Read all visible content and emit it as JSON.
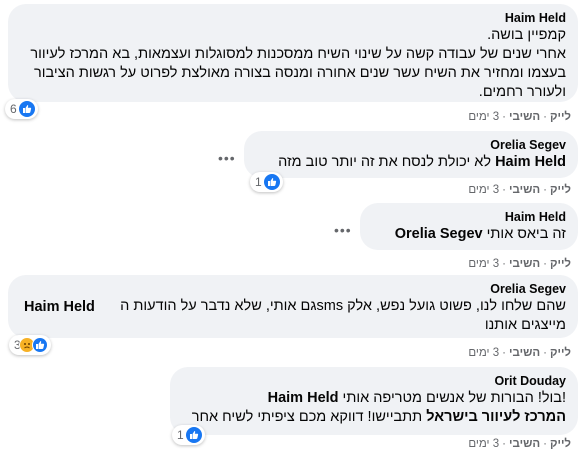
{
  "comments": [
    {
      "author": "Haim Held",
      "text": "קמפיין בושה.\nאחרי שנים של עבודה קשה על שינוי השיח ממסכנות למסוגלות ועצמאות, בא המרכז לעיוור בעצמו ומחזיר את השיח עשר שנים אחורה ומנסה בצורה מאולצת לפרוט על רגשות הציבור ולעורר רחמים.",
      "reaction_count": "6",
      "actions": {
        "like": "לייק",
        "reply": "השיבי",
        "time": "3 ימים"
      }
    },
    {
      "author": "Orelia Segev",
      "mention": "Haim Held",
      "text": " לא יכולת לנסח את זה יותר טוב מזה",
      "reaction_count": "1",
      "actions": {
        "like": "לייק",
        "reply": "השיבי",
        "time": "3 ימים"
      }
    },
    {
      "author": "Haim Held",
      "mention": "Orelia Segev",
      "text": "זה ביאס אותי ",
      "actions": {
        "like": "לייק",
        "reply": "השיבי",
        "time": "3 ימים"
      }
    },
    {
      "author": "Orelia Segev",
      "mention": "Haim Held",
      "text": "שהם שלחו לנו, פשוט גועל נפש, אלק smsגם אותי, שלא נדבר על הודעות ה \nמייצגים אותנו",
      "reaction_count": "3",
      "actions": {
        "like": "לייק",
        "reply": "השיבי",
        "time": "3 ימים"
      }
    },
    {
      "author": "Orit Douday",
      "mention": "Haim Held",
      "text_line1": "!בול! הבורות של אנשים מטריפה אותי ",
      "mention2": "המרכז לעיוור בישראל",
      "text_line2": " תתביישו! דווקא מכם ציפיתי לשיח אחר",
      "reaction_count": "1",
      "actions": {
        "like": "לייק",
        "reply": "השיבי",
        "time": "3 ימים"
      }
    }
  ],
  "icons": {
    "like": "like-thumb-icon",
    "sad": "sad-face-icon",
    "more": "more-options-icon"
  },
  "colors": {
    "bubble": "#f0f2f5",
    "like_blue": "#1877f2",
    "meta_text": "#65676b"
  }
}
